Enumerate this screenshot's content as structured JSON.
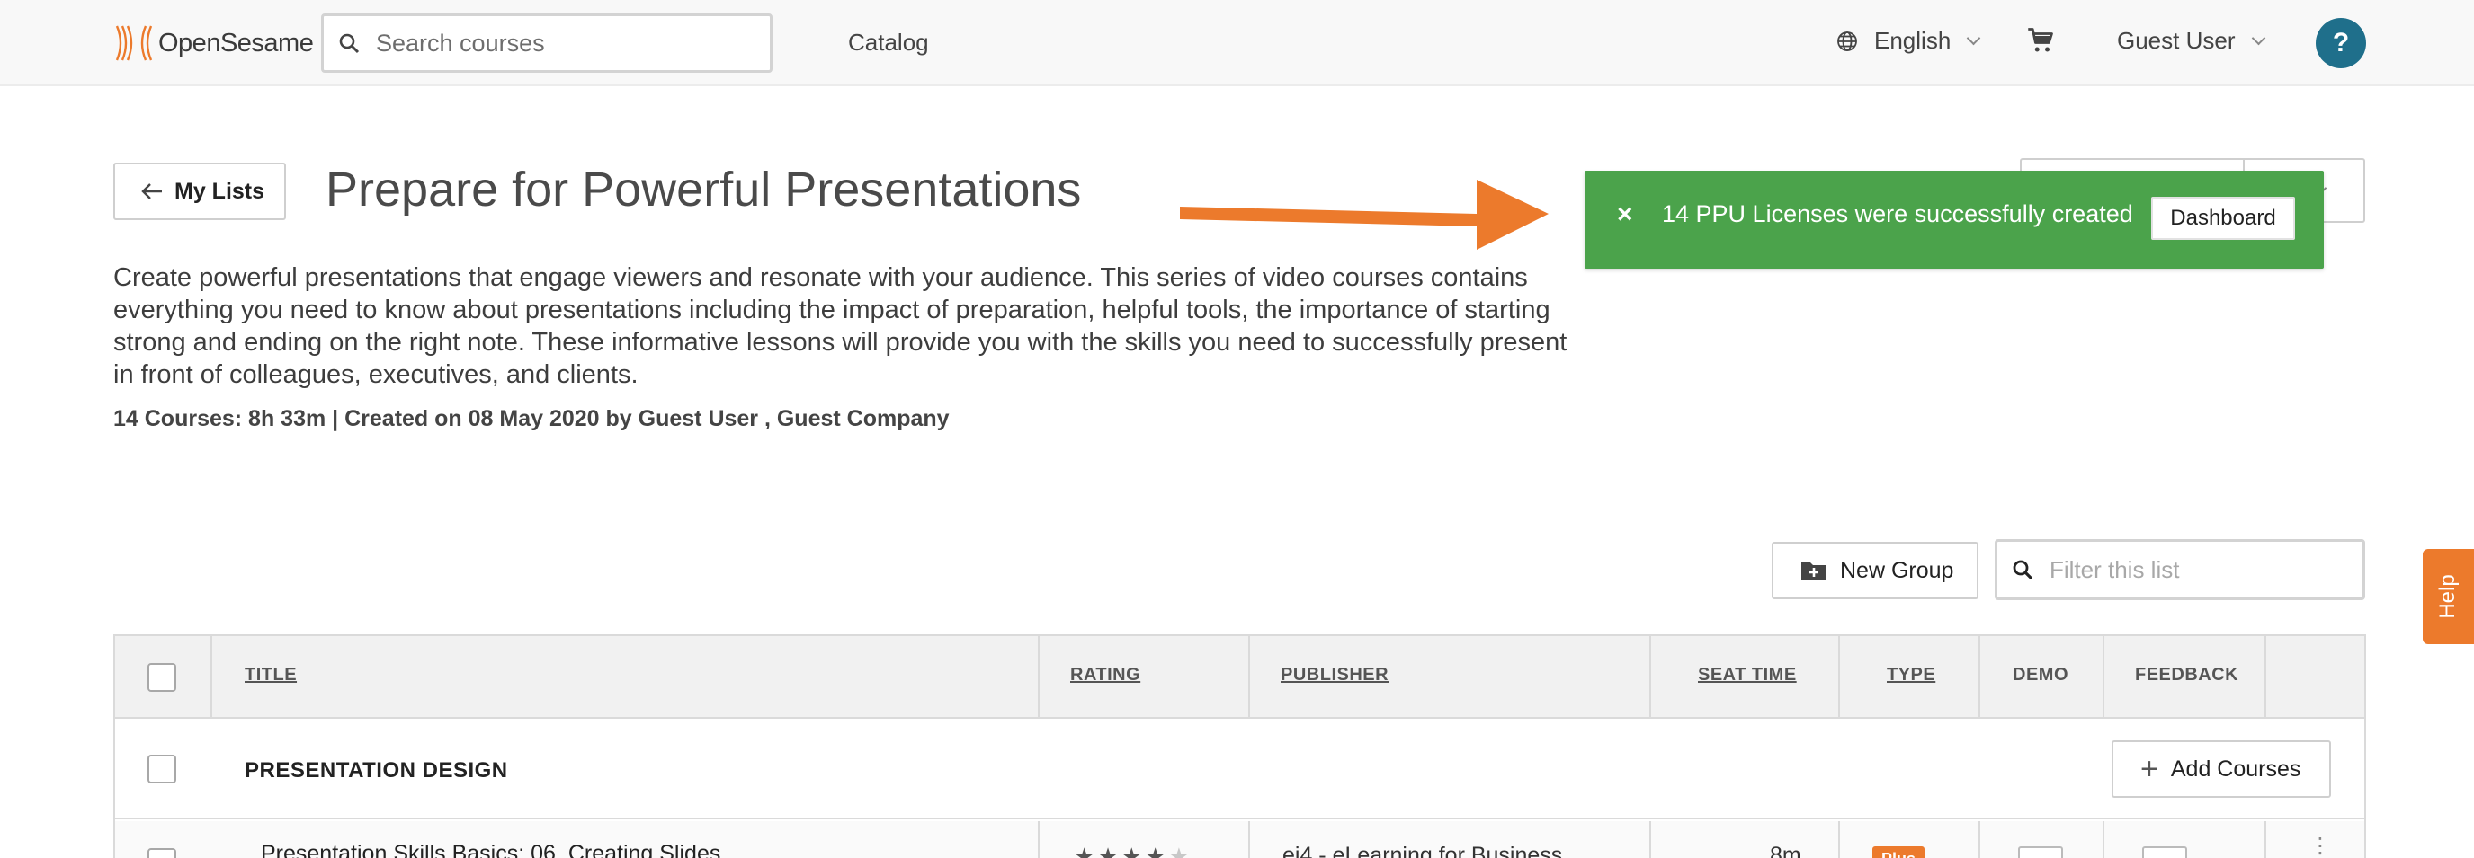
{
  "header": {
    "logo_text": "OpenSesame",
    "search_placeholder": "Search courses",
    "catalog_link": "Catalog",
    "language": "English",
    "user": "Guest User",
    "help_icon_text": "?"
  },
  "page": {
    "back_label": "My Lists",
    "title": "Prepare for Powerful Presentations",
    "description": "Create powerful presentations that engage viewers and resonate with your audience. This series of video courses contains everything you need to know about presentations including the impact of preparation, helpful tools, the importance of starting strong and ending on the right note. These informative lessons will provide you with the skills you need to successfully present in front of colleagues, executives, and clients.",
    "meta": "14 Courses: 8h 33m | Created on 08 May 2020 by Guest User , Guest Company"
  },
  "toast": {
    "close_symbol": "×",
    "message": "14 PPU Licenses were successfully created",
    "button": "Dashboard"
  },
  "toolbar": {
    "new_group": "New Group",
    "filter_placeholder": "Filter this list"
  },
  "table": {
    "columns": [
      "TITLE",
      "RATING",
      "PUBLISHER",
      "SEAT TIME",
      "TYPE",
      "DEMO",
      "FEEDBACK"
    ],
    "group": {
      "name": "PRESENTATION DESIGN",
      "add_label": "Add Courses"
    },
    "rows": [
      {
        "title": "Presentation Skills Basics: 06. Creating Slides",
        "rating": 4,
        "rating_max": 5,
        "publisher": "ej4 - eLearning for Business",
        "seat_time": "8m",
        "type": "Plus"
      }
    ]
  },
  "help_tab": "Help",
  "colors": {
    "toast_green": "#4ba34b",
    "accent_orange": "#ec7a2c",
    "help_blue": "#1f6f8b"
  }
}
